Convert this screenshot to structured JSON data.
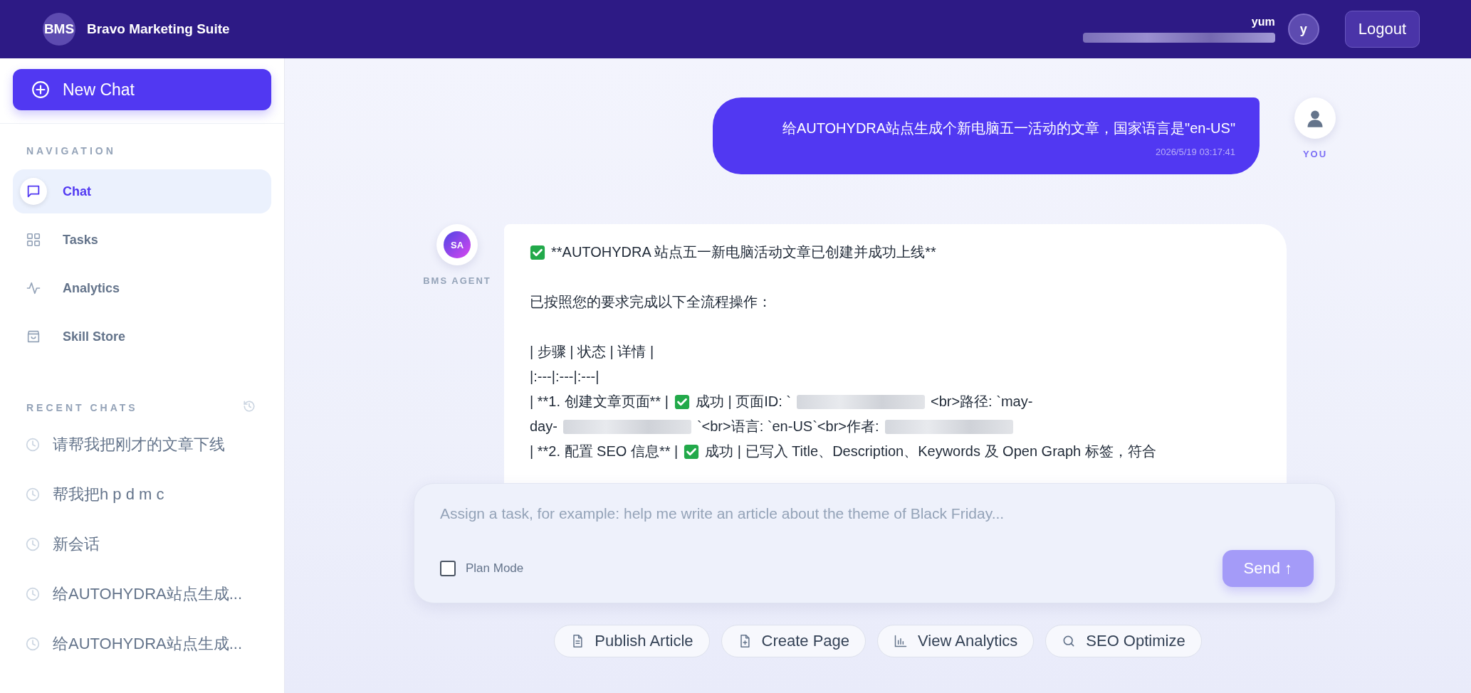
{
  "header": {
    "logo": "BMS",
    "title": "Bravo Marketing Suite",
    "user_name": "yum",
    "user_initial": "y",
    "logout": "Logout"
  },
  "sidebar": {
    "new_chat": "New Chat",
    "nav_heading": "NAVIGATION",
    "nav_items": [
      {
        "label": "Chat",
        "selected": true
      },
      {
        "label": "Tasks",
        "selected": false
      },
      {
        "label": "Analytics",
        "selected": false
      },
      {
        "label": "Skill Store",
        "selected": false
      }
    ],
    "recent_heading": "RECENT CHATS",
    "recent_chats": [
      "请帮我把刚才的文章下线",
      "帮我把h p d m c",
      "新会话",
      "给AUTOHYDRA站点生成...",
      "给AUTOHYDRA站点生成..."
    ]
  },
  "chat": {
    "messages": [
      {
        "kind": "user",
        "text": "给AUTOHYDRA站点生成个新电脑五一活动的文章，国家语言是\"en-US\"",
        "time": "2026/5/19 03:17:41",
        "author": "YOU"
      },
      {
        "kind": "agent",
        "avatar": "SA",
        "author": "BMS AGENT",
        "lines": [
          [
            {
              "kind": "check"
            },
            {
              "kind": "text",
              "text": "**AUTOHYDRA 站点五一新电脑活动文章已创建并成功上线**"
            }
          ],
          [
            {
              "kind": "blank"
            }
          ],
          [
            {
              "kind": "text",
              "text": "已按照您的要求完成以下全流程操作："
            }
          ],
          [
            {
              "kind": "blank"
            }
          ],
          [
            {
              "kind": "text",
              "text": "| 步骤 | 状态 | 详情 |"
            }
          ],
          [
            {
              "kind": "text",
              "text": "|:---|:---|:---|"
            }
          ],
          [
            {
              "kind": "text",
              "text": "| **1. 创建文章页面** |"
            },
            {
              "kind": "check"
            },
            {
              "kind": "text",
              "text": "成功 | 页面ID: `"
            },
            {
              "kind": "redacted"
            },
            {
              "kind": "text",
              "text": "<br>路径: `may-"
            }
          ],
          [
            {
              "kind": "text",
              "text": "day-"
            },
            {
              "kind": "redacted"
            },
            {
              "kind": "text",
              "text": "`<br>语言: `en-US`<br>作者: "
            },
            {
              "kind": "redacted"
            }
          ],
          [
            {
              "kind": "text",
              "text": "| **2. 配置 SEO 信息** |"
            },
            {
              "kind": "check"
            },
            {
              "kind": "text",
              "text": "成功 | 已写入 Title、Description、Keywords 及 Open Graph 标签，符合"
            }
          ]
        ]
      }
    ],
    "input": {
      "placeholder": "Assign a task, for example: help me write an article about the theme of Black Friday...",
      "plan_mode": {
        "label": "Plan Mode",
        "checked": false
      },
      "send": {
        "label": "Send ↑",
        "disabled": true
      }
    },
    "quick_actions": [
      {
        "label": "Publish Article"
      },
      {
        "label": "Create Page"
      },
      {
        "label": "View Analytics"
      },
      {
        "label": "SEO Optimize"
      }
    ]
  }
}
